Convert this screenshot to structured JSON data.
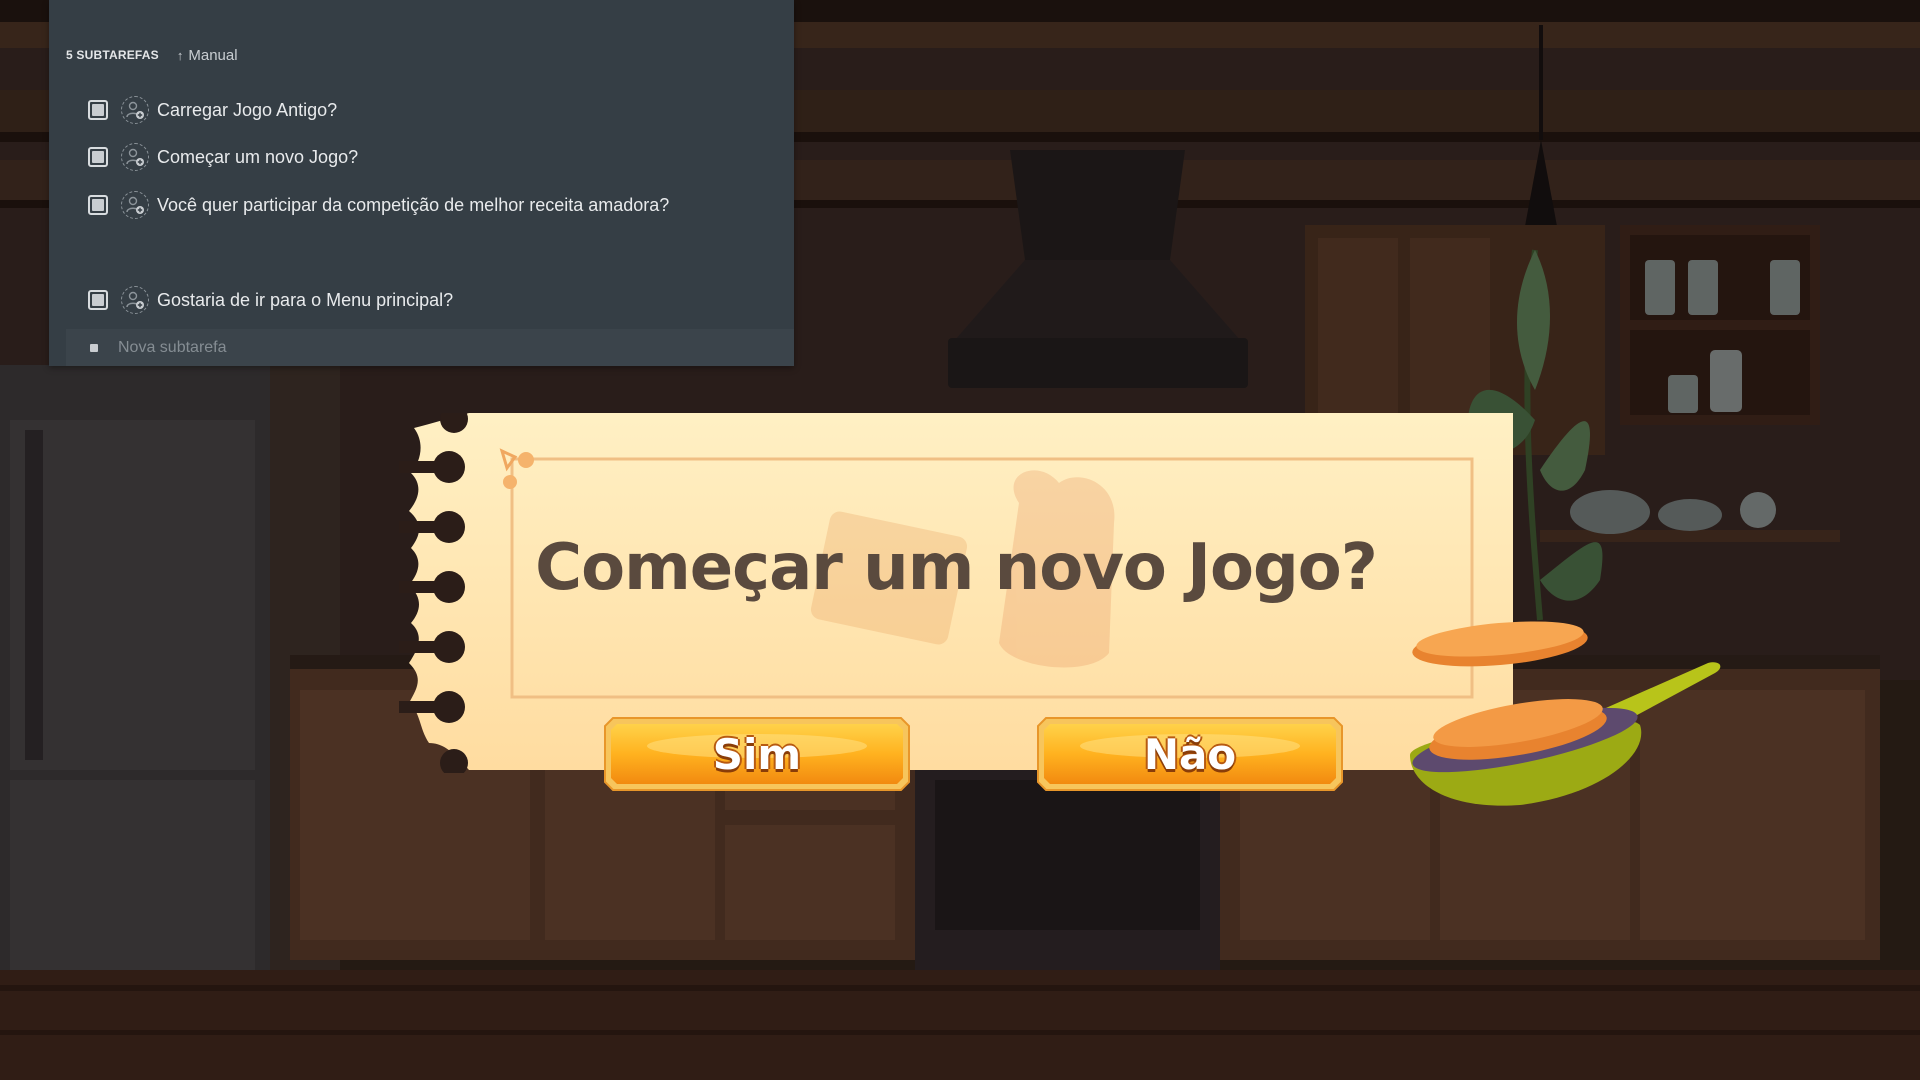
{
  "subtasks_panel": {
    "count_label": "5 SUBTAREFAS",
    "sort_label": "Manual",
    "items": [
      {
        "label": "Carregar Jogo Antigo?"
      },
      {
        "label": "Começar um novo Jogo?"
      },
      {
        "label": "Você quer participar da competição de melhor receita amadora?"
      },
      {
        "label": "Gostaria de ir para o Menu principal?"
      }
    ],
    "new_subtask_placeholder": "Nova subtarefa"
  },
  "dialog": {
    "question": "Começar um novo Jogo?",
    "yes_label": "Sim",
    "no_label": "Não"
  },
  "colors": {
    "panel_bg": "#353e45",
    "dialog_paper": "#ffe6b0",
    "title_text": "#5a4a3e",
    "button_fill": "#ffb21f",
    "button_outline": "#f2c15a"
  }
}
